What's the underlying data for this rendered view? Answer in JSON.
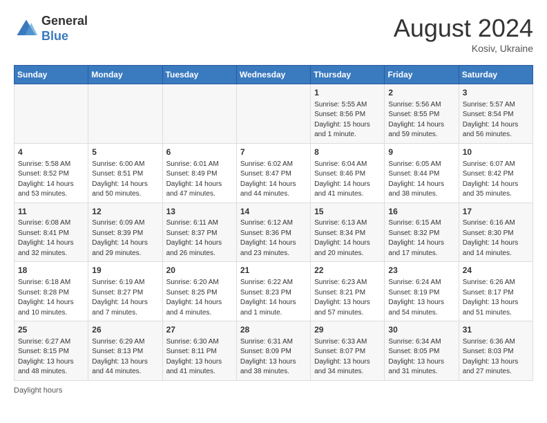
{
  "header": {
    "logo_general": "General",
    "logo_blue": "Blue",
    "month_year": "August 2024",
    "location": "Kosiv, Ukraine"
  },
  "days_of_week": [
    "Sunday",
    "Monday",
    "Tuesday",
    "Wednesday",
    "Thursday",
    "Friday",
    "Saturday"
  ],
  "weeks": [
    [
      {
        "day": "",
        "info": ""
      },
      {
        "day": "",
        "info": ""
      },
      {
        "day": "",
        "info": ""
      },
      {
        "day": "",
        "info": ""
      },
      {
        "day": "1",
        "info": "Sunrise: 5:55 AM\nSunset: 8:56 PM\nDaylight: 15 hours and 1 minute."
      },
      {
        "day": "2",
        "info": "Sunrise: 5:56 AM\nSunset: 8:55 PM\nDaylight: 14 hours and 59 minutes."
      },
      {
        "day": "3",
        "info": "Sunrise: 5:57 AM\nSunset: 8:54 PM\nDaylight: 14 hours and 56 minutes."
      }
    ],
    [
      {
        "day": "4",
        "info": "Sunrise: 5:58 AM\nSunset: 8:52 PM\nDaylight: 14 hours and 53 minutes."
      },
      {
        "day": "5",
        "info": "Sunrise: 6:00 AM\nSunset: 8:51 PM\nDaylight: 14 hours and 50 minutes."
      },
      {
        "day": "6",
        "info": "Sunrise: 6:01 AM\nSunset: 8:49 PM\nDaylight: 14 hours and 47 minutes."
      },
      {
        "day": "7",
        "info": "Sunrise: 6:02 AM\nSunset: 8:47 PM\nDaylight: 14 hours and 44 minutes."
      },
      {
        "day": "8",
        "info": "Sunrise: 6:04 AM\nSunset: 8:46 PM\nDaylight: 14 hours and 41 minutes."
      },
      {
        "day": "9",
        "info": "Sunrise: 6:05 AM\nSunset: 8:44 PM\nDaylight: 14 hours and 38 minutes."
      },
      {
        "day": "10",
        "info": "Sunrise: 6:07 AM\nSunset: 8:42 PM\nDaylight: 14 hours and 35 minutes."
      }
    ],
    [
      {
        "day": "11",
        "info": "Sunrise: 6:08 AM\nSunset: 8:41 PM\nDaylight: 14 hours and 32 minutes."
      },
      {
        "day": "12",
        "info": "Sunrise: 6:09 AM\nSunset: 8:39 PM\nDaylight: 14 hours and 29 minutes."
      },
      {
        "day": "13",
        "info": "Sunrise: 6:11 AM\nSunset: 8:37 PM\nDaylight: 14 hours and 26 minutes."
      },
      {
        "day": "14",
        "info": "Sunrise: 6:12 AM\nSunset: 8:36 PM\nDaylight: 14 hours and 23 minutes."
      },
      {
        "day": "15",
        "info": "Sunrise: 6:13 AM\nSunset: 8:34 PM\nDaylight: 14 hours and 20 minutes."
      },
      {
        "day": "16",
        "info": "Sunrise: 6:15 AM\nSunset: 8:32 PM\nDaylight: 14 hours and 17 minutes."
      },
      {
        "day": "17",
        "info": "Sunrise: 6:16 AM\nSunset: 8:30 PM\nDaylight: 14 hours and 14 minutes."
      }
    ],
    [
      {
        "day": "18",
        "info": "Sunrise: 6:18 AM\nSunset: 8:28 PM\nDaylight: 14 hours and 10 minutes."
      },
      {
        "day": "19",
        "info": "Sunrise: 6:19 AM\nSunset: 8:27 PM\nDaylight: 14 hours and 7 minutes."
      },
      {
        "day": "20",
        "info": "Sunrise: 6:20 AM\nSunset: 8:25 PM\nDaylight: 14 hours and 4 minutes."
      },
      {
        "day": "21",
        "info": "Sunrise: 6:22 AM\nSunset: 8:23 PM\nDaylight: 14 hours and 1 minute."
      },
      {
        "day": "22",
        "info": "Sunrise: 6:23 AM\nSunset: 8:21 PM\nDaylight: 13 hours and 57 minutes."
      },
      {
        "day": "23",
        "info": "Sunrise: 6:24 AM\nSunset: 8:19 PM\nDaylight: 13 hours and 54 minutes."
      },
      {
        "day": "24",
        "info": "Sunrise: 6:26 AM\nSunset: 8:17 PM\nDaylight: 13 hours and 51 minutes."
      }
    ],
    [
      {
        "day": "25",
        "info": "Sunrise: 6:27 AM\nSunset: 8:15 PM\nDaylight: 13 hours and 48 minutes."
      },
      {
        "day": "26",
        "info": "Sunrise: 6:29 AM\nSunset: 8:13 PM\nDaylight: 13 hours and 44 minutes."
      },
      {
        "day": "27",
        "info": "Sunrise: 6:30 AM\nSunset: 8:11 PM\nDaylight: 13 hours and 41 minutes."
      },
      {
        "day": "28",
        "info": "Sunrise: 6:31 AM\nSunset: 8:09 PM\nDaylight: 13 hours and 38 minutes."
      },
      {
        "day": "29",
        "info": "Sunrise: 6:33 AM\nSunset: 8:07 PM\nDaylight: 13 hours and 34 minutes."
      },
      {
        "day": "30",
        "info": "Sunrise: 6:34 AM\nSunset: 8:05 PM\nDaylight: 13 hours and 31 minutes."
      },
      {
        "day": "31",
        "info": "Sunrise: 6:36 AM\nSunset: 8:03 PM\nDaylight: 13 hours and 27 minutes."
      }
    ]
  ],
  "footer": {
    "note": "Daylight hours"
  }
}
